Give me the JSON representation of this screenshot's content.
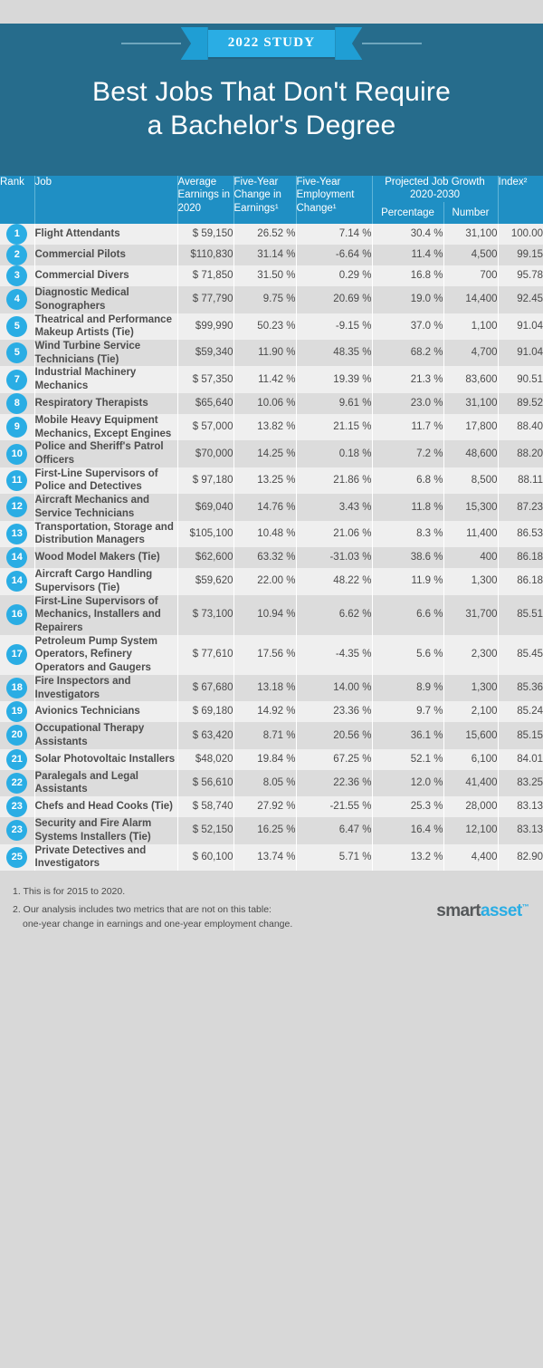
{
  "hero": {
    "ribbon_label": "2022 STUDY",
    "title_line1": "Best Jobs That Don't Require",
    "title_line2": "a Bachelor's Degree"
  },
  "colors": {
    "hero_bg": "#266c8c",
    "header_bg": "#1f8fc4",
    "accent": "#2aade4",
    "row_odd": "#efefef",
    "row_even": "#dcdcdc",
    "text": "#4a4a4a"
  },
  "table": {
    "headers": {
      "rank": "Rank",
      "job": "Job",
      "avg_earnings": "Average Earnings in 2020",
      "five_year_earnings": "Five-Year Change in Earnings¹",
      "five_year_employment": "Five-Year Employment Change¹",
      "projected_group": "Projected Job Growth 2020-2030",
      "projected_percentage": "Percentage",
      "projected_number": "Number",
      "index": "Index²"
    },
    "rows": [
      {
        "rank": "1",
        "job": "Flight Attendants",
        "earnings": "$ 59,150",
        "chg_earn": "26.52 %",
        "chg_emp": "7.14 %",
        "pct": "30.4 %",
        "num": "31,100",
        "index": "100.00"
      },
      {
        "rank": "2",
        "job": "Commercial Pilots",
        "earnings": "$110,830",
        "chg_earn": "31.14 %",
        "chg_emp": "-6.64 %",
        "pct": "11.4 %",
        "num": "4,500",
        "index": "99.15"
      },
      {
        "rank": "3",
        "job": "Commercial Divers",
        "earnings": "$ 71,850",
        "chg_earn": "31.50 %",
        "chg_emp": "0.29 %",
        "pct": "16.8 %",
        "num": "700",
        "index": "95.78"
      },
      {
        "rank": "4",
        "job": "Diagnostic Medical Sonographers",
        "earnings": "$ 77,790",
        "chg_earn": "9.75 %",
        "chg_emp": "20.69 %",
        "pct": "19.0 %",
        "num": "14,400",
        "index": "92.45"
      },
      {
        "rank": "5",
        "job": "Theatrical and Performance Makeup Artists (Tie)",
        "earnings": "$99,990",
        "chg_earn": "50.23 %",
        "chg_emp": "-9.15 %",
        "pct": "37.0 %",
        "num": "1,100",
        "index": "91.04"
      },
      {
        "rank": "5",
        "job": "Wind Turbine Service Technicians (Tie)",
        "earnings": "$59,340",
        "chg_earn": "11.90 %",
        "chg_emp": "48.35 %",
        "pct": "68.2 %",
        "num": "4,700",
        "index": "91.04"
      },
      {
        "rank": "7",
        "job": "Industrial Machinery Mechanics",
        "earnings": "$ 57,350",
        "chg_earn": "11.42 %",
        "chg_emp": "19.39 %",
        "pct": "21.3 %",
        "num": "83,600",
        "index": "90.51"
      },
      {
        "rank": "8",
        "job": "Respiratory Therapists",
        "earnings": "$65,640",
        "chg_earn": "10.06 %",
        "chg_emp": "9.61 %",
        "pct": "23.0 %",
        "num": "31,100",
        "index": "89.52"
      },
      {
        "rank": "9",
        "job": "Mobile Heavy Equipment Mechanics, Except Engines",
        "earnings": "$ 57,000",
        "chg_earn": "13.82 %",
        "chg_emp": "21.15 %",
        "pct": "11.7 %",
        "num": "17,800",
        "index": "88.40"
      },
      {
        "rank": "10",
        "job": "Police and Sheriff's Patrol Officers",
        "earnings": "$70,000",
        "chg_earn": "14.25 %",
        "chg_emp": "0.18 %",
        "pct": "7.2 %",
        "num": "48,600",
        "index": "88.20"
      },
      {
        "rank": "11",
        "job": "First-Line Supervisors of Police and Detectives",
        "earnings": "$  97,180",
        "chg_earn": "13.25 %",
        "chg_emp": "21.86 %",
        "pct": "6.8 %",
        "num": "8,500",
        "index": "88.11"
      },
      {
        "rank": "12",
        "job": "Aircraft Mechanics and Service Technicians",
        "earnings": "$69,040",
        "chg_earn": "14.76 %",
        "chg_emp": "3.43 %",
        "pct": "11.8 %",
        "num": "15,300",
        "index": "87.23"
      },
      {
        "rank": "13",
        "job": "Transportation, Storage and Distribution Managers",
        "earnings": "$105,100",
        "chg_earn": "10.48 %",
        "chg_emp": "21.06 %",
        "pct": "8.3 %",
        "num": "11,400",
        "index": "86.53"
      },
      {
        "rank": "14",
        "job": "Wood Model Makers (Tie)",
        "earnings": "$62,600",
        "chg_earn": "63.32 %",
        "chg_emp": "-31.03 %",
        "pct": "38.6 %",
        "num": "400",
        "index": "86.18"
      },
      {
        "rank": "14",
        "job": "Aircraft Cargo Handling Supervisors (Tie)",
        "earnings": "$59,620",
        "chg_earn": "22.00 %",
        "chg_emp": "48.22 %",
        "pct": "11.9 %",
        "num": "1,300",
        "index": "86.18"
      },
      {
        "rank": "16",
        "job": "First-Line Supervisors of Mechanics, Installers and Repairers",
        "earnings": "$ 73,100",
        "chg_earn": "10.94 %",
        "chg_emp": "6.62 %",
        "pct": "6.6 %",
        "num": "31,700",
        "index": "85.51"
      },
      {
        "rank": "17",
        "job": "Petroleum Pump System Operators, Refinery Operators and Gaugers",
        "earnings": "$  77,610",
        "chg_earn": "17.56 %",
        "chg_emp": "-4.35 %",
        "pct": "5.6 %",
        "num": "2,300",
        "index": "85.45"
      },
      {
        "rank": "18",
        "job": "Fire Inspectors and Investigators",
        "earnings": "$ 67,680",
        "chg_earn": "13.18 %",
        "chg_emp": "14.00 %",
        "pct": "8.9 %",
        "num": "1,300",
        "index": "85.36"
      },
      {
        "rank": "19",
        "job": "Avionics Technicians",
        "earnings": "$ 69,180",
        "chg_earn": "14.92 %",
        "chg_emp": "23.36 %",
        "pct": "9.7 %",
        "num": "2,100",
        "index": "85.24"
      },
      {
        "rank": "20",
        "job": "Occupational Therapy Assistants",
        "earnings": "$ 63,420",
        "chg_earn": "8.71 %",
        "chg_emp": "20.56 %",
        "pct": "36.1 %",
        "num": "15,600",
        "index": "85.15"
      },
      {
        "rank": "21",
        "job": "Solar Photovoltaic Installers",
        "earnings": "$48,020",
        "chg_earn": "19.84 %",
        "chg_emp": "67.25 %",
        "pct": "52.1 %",
        "num": "6,100",
        "index": "84.01"
      },
      {
        "rank": "22",
        "job": "Paralegals and Legal Assistants",
        "earnings": "$ 56,610",
        "chg_earn": "8.05 %",
        "chg_emp": "22.36 %",
        "pct": "12.0 %",
        "num": "41,400",
        "index": "83.25"
      },
      {
        "rank": "23",
        "job": "Chefs and Head Cooks (Tie)",
        "earnings": "$ 58,740",
        "chg_earn": "27.92 %",
        "chg_emp": "-21.55 %",
        "pct": "25.3 %",
        "num": "28,000",
        "index": "83.13"
      },
      {
        "rank": "23",
        "job": "Security and Fire Alarm Systems Installers (Tie)",
        "earnings": "$ 52,150",
        "chg_earn": "16.25 %",
        "chg_emp": "6.47 %",
        "pct": "16.4 %",
        "num": "12,100",
        "index": "83.13"
      },
      {
        "rank": "25",
        "job": "Private Detectives and Investigators",
        "earnings": "$ 60,100",
        "chg_earn": "13.74 %",
        "chg_emp": "5.71 %",
        "pct": "13.2 %",
        "num": "4,400",
        "index": "82.90"
      }
    ]
  },
  "footnotes": {
    "note1": "1. This is for 2015 to 2020.",
    "note2": "2. Our analysis includes two metrics that are not on this table:",
    "note2b": "one-year change in earnings and one-year employment change."
  },
  "logo": {
    "part1": "smart",
    "part2": "asset",
    "tm": "™"
  }
}
